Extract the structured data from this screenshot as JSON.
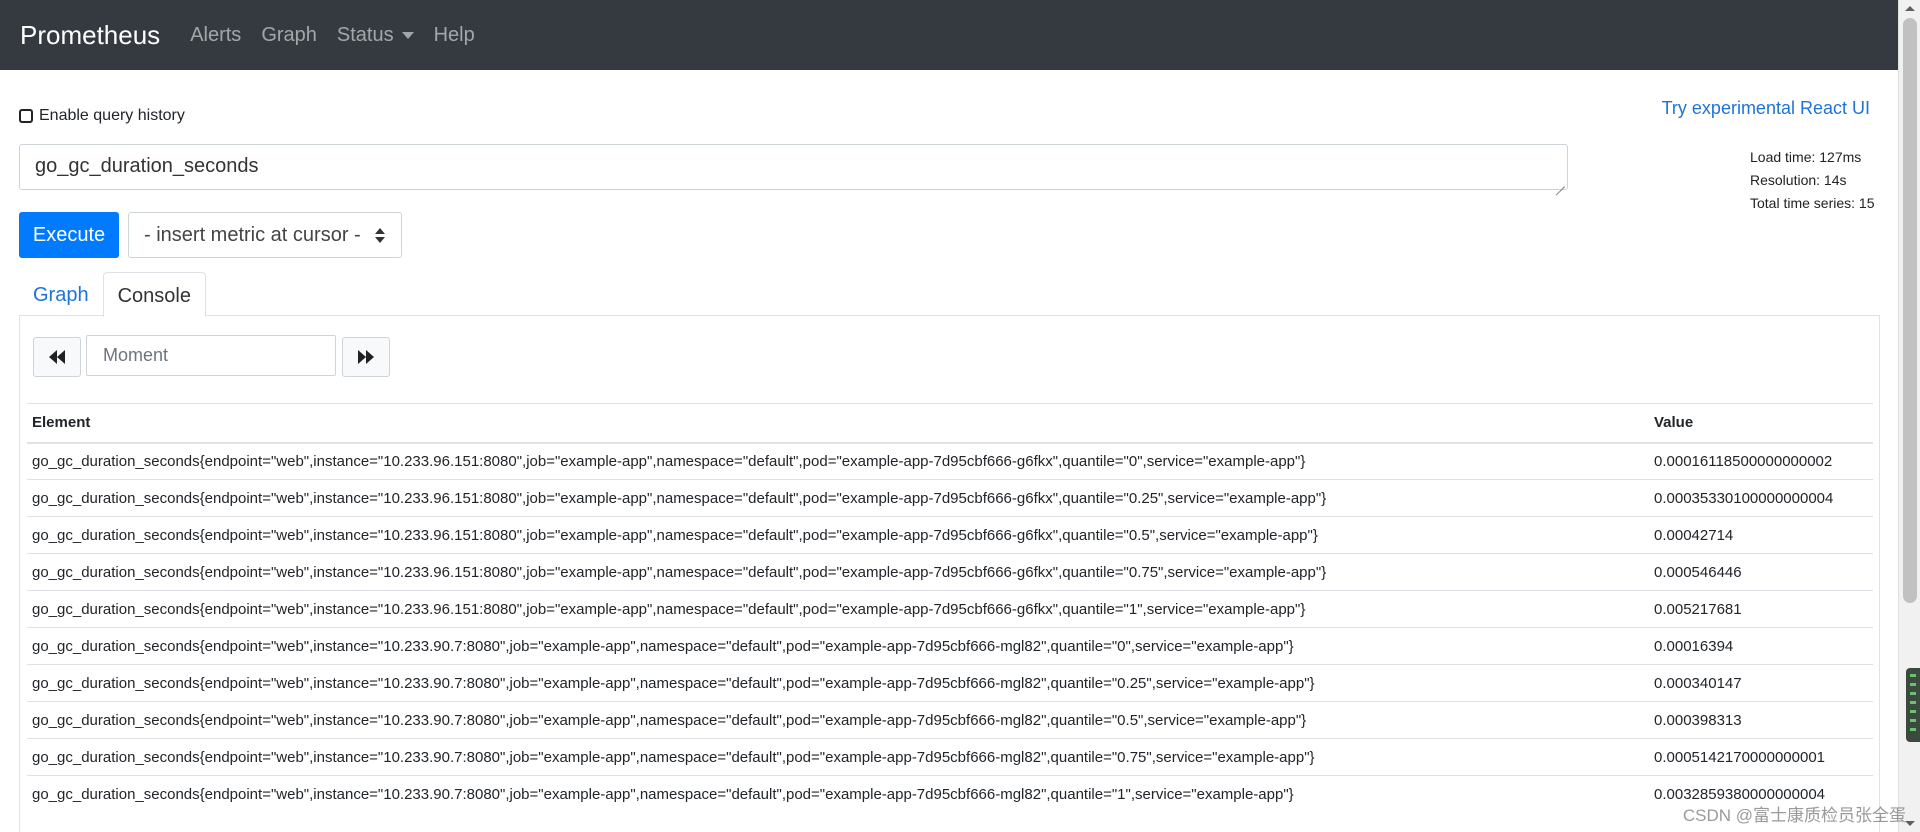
{
  "navbar": {
    "brand": "Prometheus",
    "items": [
      {
        "label": "Alerts"
      },
      {
        "label": "Graph"
      },
      {
        "label": "Status"
      },
      {
        "label": "Help"
      }
    ]
  },
  "history": {
    "label": "Enable query history",
    "checked": false
  },
  "react_link": "Try experimental React UI",
  "query": {
    "value": "go_gc_duration_seconds"
  },
  "stats": {
    "load_time": "Load time: 127ms",
    "resolution": "Resolution: 14s",
    "total_series": "Total time series: 15"
  },
  "execute_label": "Execute",
  "metric_select": "- insert metric at cursor -",
  "tabs": [
    {
      "label": "Graph",
      "active": false
    },
    {
      "label": "Console",
      "active": true
    }
  ],
  "moment": {
    "placeholder": "Moment"
  },
  "table": {
    "headers": {
      "element": "Element",
      "value": "Value"
    },
    "rows": [
      {
        "element": "go_gc_duration_seconds{endpoint=\"web\",instance=\"10.233.96.151:8080\",job=\"example-app\",namespace=\"default\",pod=\"example-app-7d95cbf666-g6fkx\",quantile=\"0\",service=\"example-app\"}",
        "value": "0.00016118500000000002"
      },
      {
        "element": "go_gc_duration_seconds{endpoint=\"web\",instance=\"10.233.96.151:8080\",job=\"example-app\",namespace=\"default\",pod=\"example-app-7d95cbf666-g6fkx\",quantile=\"0.25\",service=\"example-app\"}",
        "value": "0.00035330100000000004"
      },
      {
        "element": "go_gc_duration_seconds{endpoint=\"web\",instance=\"10.233.96.151:8080\",job=\"example-app\",namespace=\"default\",pod=\"example-app-7d95cbf666-g6fkx\",quantile=\"0.5\",service=\"example-app\"}",
        "value": "0.00042714"
      },
      {
        "element": "go_gc_duration_seconds{endpoint=\"web\",instance=\"10.233.96.151:8080\",job=\"example-app\",namespace=\"default\",pod=\"example-app-7d95cbf666-g6fkx\",quantile=\"0.75\",service=\"example-app\"}",
        "value": "0.000546446"
      },
      {
        "element": "go_gc_duration_seconds{endpoint=\"web\",instance=\"10.233.96.151:8080\",job=\"example-app\",namespace=\"default\",pod=\"example-app-7d95cbf666-g6fkx\",quantile=\"1\",service=\"example-app\"}",
        "value": "0.005217681"
      },
      {
        "element": "go_gc_duration_seconds{endpoint=\"web\",instance=\"10.233.90.7:8080\",job=\"example-app\",namespace=\"default\",pod=\"example-app-7d95cbf666-mgl82\",quantile=\"0\",service=\"example-app\"}",
        "value": "0.00016394"
      },
      {
        "element": "go_gc_duration_seconds{endpoint=\"web\",instance=\"10.233.90.7:8080\",job=\"example-app\",namespace=\"default\",pod=\"example-app-7d95cbf666-mgl82\",quantile=\"0.25\",service=\"example-app\"}",
        "value": "0.000340147"
      },
      {
        "element": "go_gc_duration_seconds{endpoint=\"web\",instance=\"10.233.90.7:8080\",job=\"example-app\",namespace=\"default\",pod=\"example-app-7d95cbf666-mgl82\",quantile=\"0.5\",service=\"example-app\"}",
        "value": "0.000398313"
      },
      {
        "element": "go_gc_duration_seconds{endpoint=\"web\",instance=\"10.233.90.7:8080\",job=\"example-app\",namespace=\"default\",pod=\"example-app-7d95cbf666-mgl82\",quantile=\"0.75\",service=\"example-app\"}",
        "value": "0.0005142170000000001"
      },
      {
        "element": "go_gc_duration_seconds{endpoint=\"web\",instance=\"10.233.90.7:8080\",job=\"example-app\",namespace=\"default\",pod=\"example-app-7d95cbf666-mgl82\",quantile=\"1\",service=\"example-app\"}",
        "value": "0.0032859380000000004"
      }
    ]
  },
  "watermark": "CSDN @富士康质检员张全蛋"
}
